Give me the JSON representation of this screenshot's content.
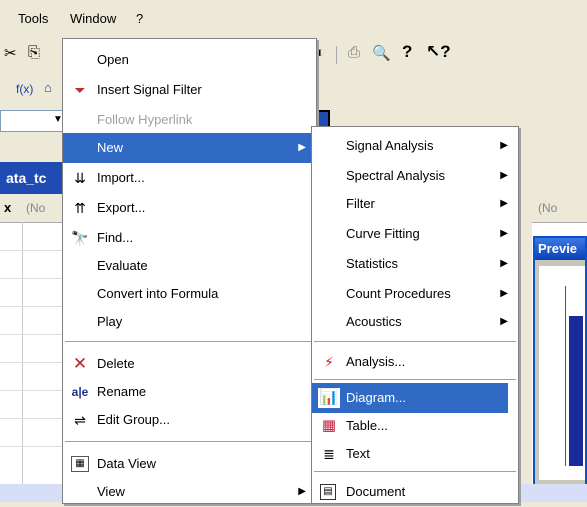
{
  "menubar": {
    "items": [
      "Tools",
      "Window",
      "?"
    ]
  },
  "toolbar": {
    "fx_label": "f(x)"
  },
  "table": {
    "title_fragment": "ata_tc",
    "col_left": "(No",
    "col_right": "(No"
  },
  "preview": {
    "title": "Previe"
  },
  "context_menu": {
    "items": [
      {
        "label": "Open"
      },
      {
        "label": "Insert Signal Filter"
      },
      {
        "label": "Follow Hyperlink"
      },
      {
        "label": "New"
      },
      {
        "label": "Import..."
      },
      {
        "label": "Export..."
      },
      {
        "label": "Find..."
      },
      {
        "label": "Evaluate"
      },
      {
        "label": "Convert into Formula"
      },
      {
        "label": "Play"
      },
      {
        "label": "Delete"
      },
      {
        "label": "Rename"
      },
      {
        "label": "Edit Group..."
      },
      {
        "label": "Data View"
      },
      {
        "label": "View"
      }
    ]
  },
  "submenu": {
    "items": [
      {
        "label": "Signal Analysis"
      },
      {
        "label": "Spectral Analysis"
      },
      {
        "label": "Filter"
      },
      {
        "label": "Curve Fitting"
      },
      {
        "label": "Statistics"
      },
      {
        "label": "Count Procedures"
      },
      {
        "label": "Acoustics"
      },
      {
        "label": "Analysis..."
      },
      {
        "label": "Diagram..."
      },
      {
        "label": "Table..."
      },
      {
        "label": "Text"
      },
      {
        "label": "Document"
      }
    ]
  },
  "colors": {
    "highlight": "#316ac5",
    "title_blue": "#1f4bb2",
    "menu_bg": "#ffffff",
    "disabled": "#a0a0a0"
  }
}
